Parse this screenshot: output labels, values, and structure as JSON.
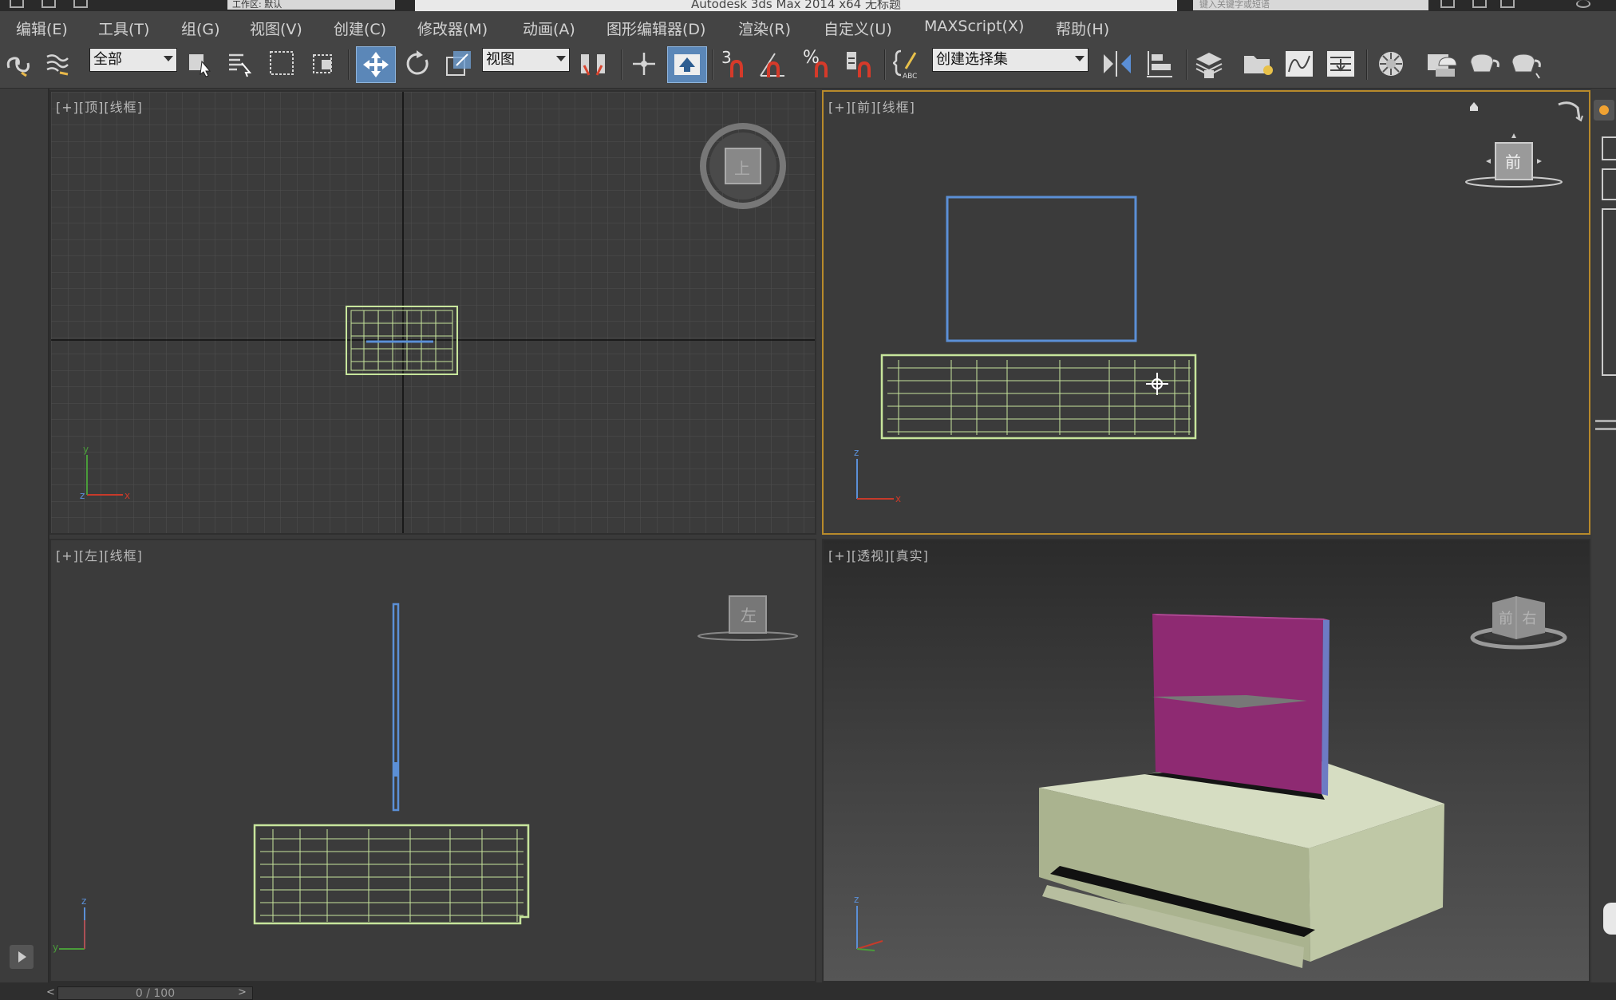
{
  "app": {
    "title": "Autodesk 3ds Max 2014 x64    无标题",
    "search_placeholder": "键入关键字或短语",
    "workspace": "工作区: 默认"
  },
  "menu": [
    "编辑(E)",
    "工具(T)",
    "组(G)",
    "视图(V)",
    "创建(C)",
    "修改器(M)",
    "动画(A)",
    "图形编辑器(D)",
    "渲染(R)",
    "自定义(U)",
    "MAXScript(X)",
    "帮助(H)"
  ],
  "toolbar": {
    "selection_filter": "全部",
    "reference_coord": "视图",
    "named_selection": "创建选择集",
    "snap_3": "3",
    "percent": "%"
  },
  "viewports": {
    "top": {
      "label": "[+][顶][线框]",
      "cube_text": "上"
    },
    "front": {
      "label": "[+][前][线框]",
      "cube_text": "前"
    },
    "left": {
      "label": "[+][左][线框]",
      "cube_text": "左"
    },
    "perspective": {
      "label": "[+][透视][真实]",
      "cube_text": "前  右"
    }
  },
  "timeline": {
    "frame": "0 / 100"
  },
  "colors": {
    "wire_green": "#c7e59c",
    "wire_blue": "#5b8fd6",
    "active_border": "#b88a2b",
    "screen_magenta": "#8e2a72",
    "base_green": "#c9d4b0"
  }
}
